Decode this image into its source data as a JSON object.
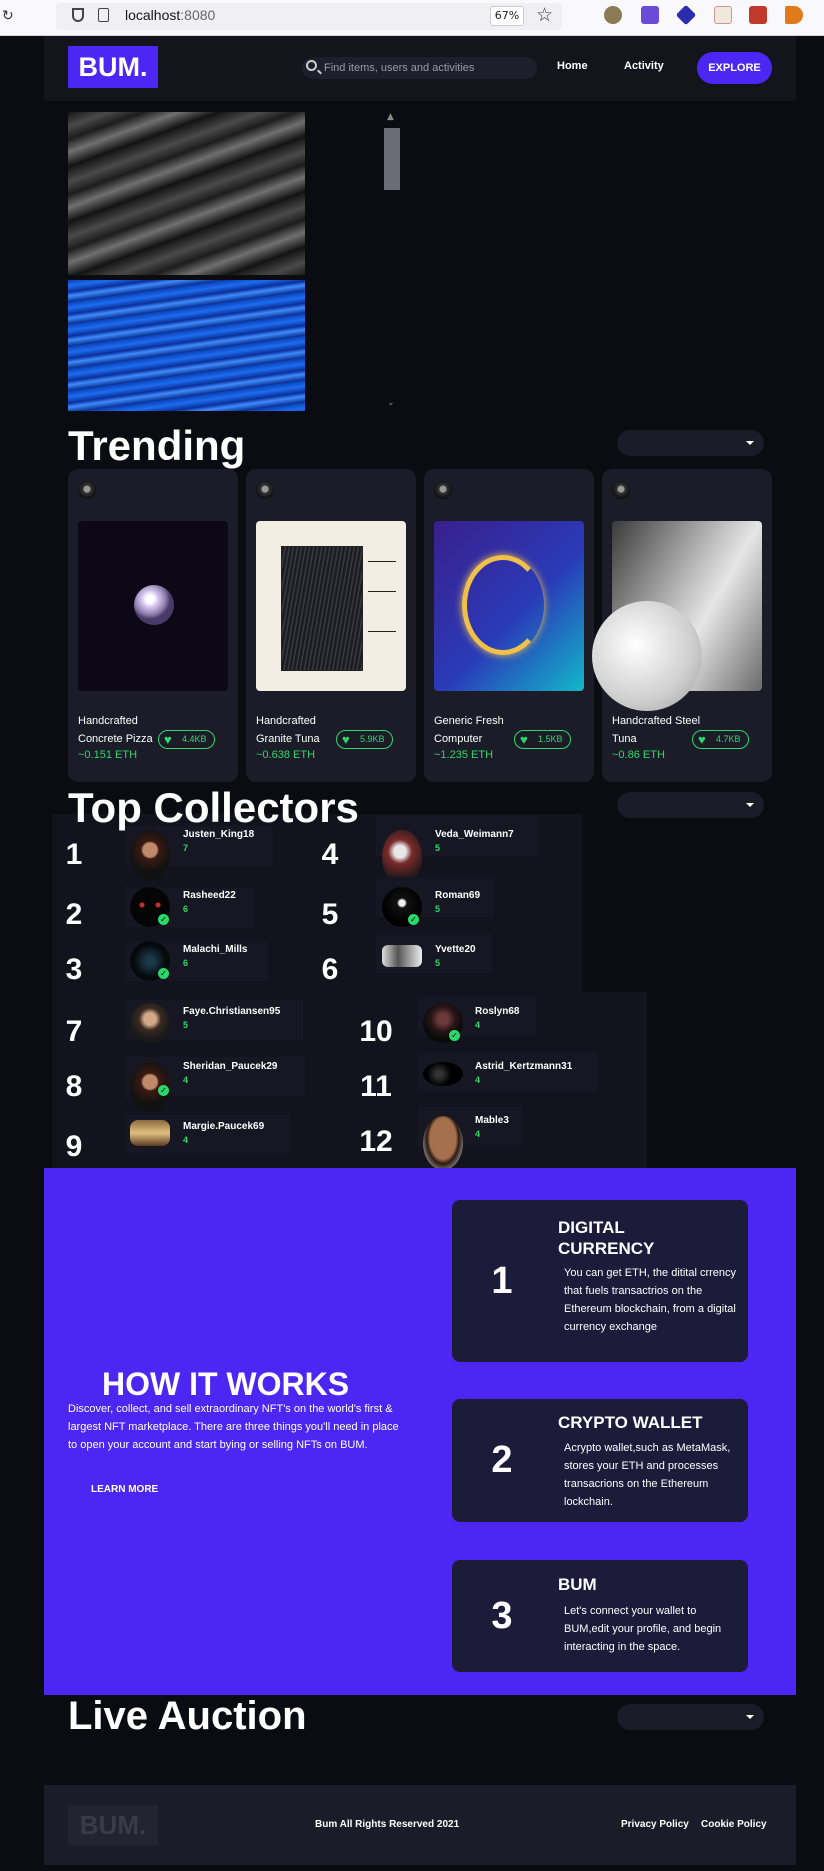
{
  "browser": {
    "url_host": "localhost",
    "url_port": ":8080",
    "zoom": "67%"
  },
  "nav": {
    "logo": "BUM.",
    "search_placeholder": "Find items, users and activities",
    "home": "Home",
    "activity": "Activity",
    "explore": "EXPLORE"
  },
  "trending": {
    "title": "Trending",
    "cards": [
      {
        "name": "Handcrafted Concrete Pizza",
        "price": "~0.151 ETH",
        "likes": "4.4KB"
      },
      {
        "name": "Handcrafted Granite Tuna",
        "price": "~0.638 ETH",
        "likes": "5.9KB"
      },
      {
        "name": "Generic Fresh Computer",
        "price": "~1.235 ETH",
        "likes": "1.5KB"
      },
      {
        "name": "Handcrafted Steel Tuna",
        "price": "~0.86 ETH",
        "likes": "4.7KB"
      }
    ]
  },
  "collectors": {
    "title": "Top Collectors",
    "items": [
      {
        "rank": "1",
        "name": "Justen_King18",
        "count": "7"
      },
      {
        "rank": "2",
        "name": "Rasheed22",
        "count": "6"
      },
      {
        "rank": "3",
        "name": "Malachi_Mills",
        "count": "6"
      },
      {
        "rank": "4",
        "name": "Veda_Weimann7",
        "count": "5"
      },
      {
        "rank": "5",
        "name": "Roman69",
        "count": "5"
      },
      {
        "rank": "6",
        "name": "Yvette20",
        "count": "5"
      },
      {
        "rank": "7",
        "name": "Faye.Christiansen95",
        "count": "5"
      },
      {
        "rank": "8",
        "name": "Sheridan_Paucek29",
        "count": "4"
      },
      {
        "rank": "9",
        "name": "Margie.Paucek69",
        "count": "4"
      },
      {
        "rank": "10",
        "name": "Roslyn68",
        "count": "4"
      },
      {
        "rank": "11",
        "name": "Astrid_Kertzmann31",
        "count": "4"
      },
      {
        "rank": "12",
        "name": "Mable3",
        "count": "4"
      }
    ]
  },
  "how": {
    "title": "HOW IT WORKS",
    "desc": "Discover, collect, and sell extraordinary NFT's on the world's first & largest NFT marketplace. There are three things you'll need in place to open your account and start bying or selling NFTs on BUM.",
    "learn_more": "LEARN MORE",
    "steps": [
      {
        "num": "1",
        "title": "DIGITAL CURRENCY",
        "text": "You can get ETH, the ditital crrency that fuels transactrios on the Ethereum blockchain, from a digital currency exchange"
      },
      {
        "num": "2",
        "title": "CRYPTO WALLET",
        "text": "Acrypto wallet,such as MetaMask, stores your ETH and processes transacrions on the Ethereum lockchain."
      },
      {
        "num": "3",
        "title": "BUM",
        "text": "Let's connect your wallet to BUM,edit your profile, and begin interacting in the space."
      }
    ]
  },
  "auction": {
    "title": "Live Auction"
  },
  "footer": {
    "logo": "BUM.",
    "copyright": "Bum All Rights Reserved 2021",
    "privacy": "Privacy Policy",
    "cookie": "Cookie Policy"
  },
  "colors": {
    "accent": "#4c27f4",
    "green": "#2bd86a",
    "background": "#0b0b12",
    "card": "#1c1c28"
  }
}
